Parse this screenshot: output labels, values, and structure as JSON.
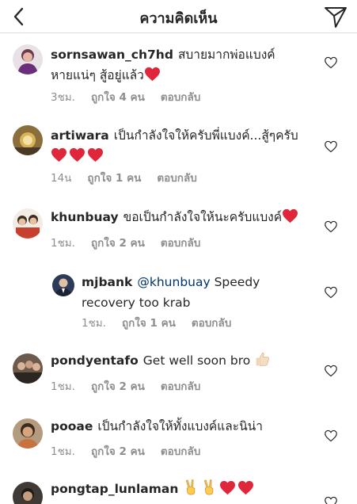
{
  "header": {
    "title": "ความคิดเห็น",
    "back_icon": "chevron-left-icon",
    "send_icon": "paper-plane-icon"
  },
  "comments": [
    {
      "username": "sornsawan_ch7hd",
      "text": "สบายมากพ่อแบงค์",
      "text2": "หายแน่ๆ สู้อยู่แล้ว",
      "time": "3ชม.",
      "likes": "ถูกใจ 4 คน",
      "reply": "ตอบกลับ"
    },
    {
      "username": "artiwara",
      "text": "เป็นกำลังใจให้ครับพี่แบงค์...สู้ๆครับ",
      "time": "14น",
      "likes": "ถูกใจ 1 คน",
      "reply": "ตอบกลับ"
    },
    {
      "username": "khunbuay",
      "text": "ขอเป็นกำลังใจให้นะครับแบงค์",
      "time": "1ชม.",
      "likes": "ถูกใจ 2 คน",
      "reply": "ตอบกลับ"
    },
    {
      "username": "mjbank",
      "mention": "@khunbuay",
      "text": "Speedy",
      "text2": "recovery too krab",
      "time": "1ชม.",
      "likes": "ถูกใจ 1 คน",
      "reply": "ตอบกลับ"
    },
    {
      "username": "pondyentafo",
      "text": "Get well soon bro",
      "time": "1ชม.",
      "likes": "ถูกใจ 2 คน",
      "reply": "ตอบกลับ"
    },
    {
      "username": "pooae",
      "text": "เป็นกำลังใจให้ทั้งแบงค์และนิน่า",
      "time": "1ชม.",
      "likes": "ถูกใจ 2 คน",
      "reply": "ตอบกลับ"
    },
    {
      "username": "pongtap_lunlaman",
      "text": ""
    }
  ],
  "colors": {
    "text": "#262626",
    "meta": "#8e8e8e",
    "heart_red": "#ed4956",
    "mention": "#003569",
    "divider": "#dbdbdb"
  }
}
